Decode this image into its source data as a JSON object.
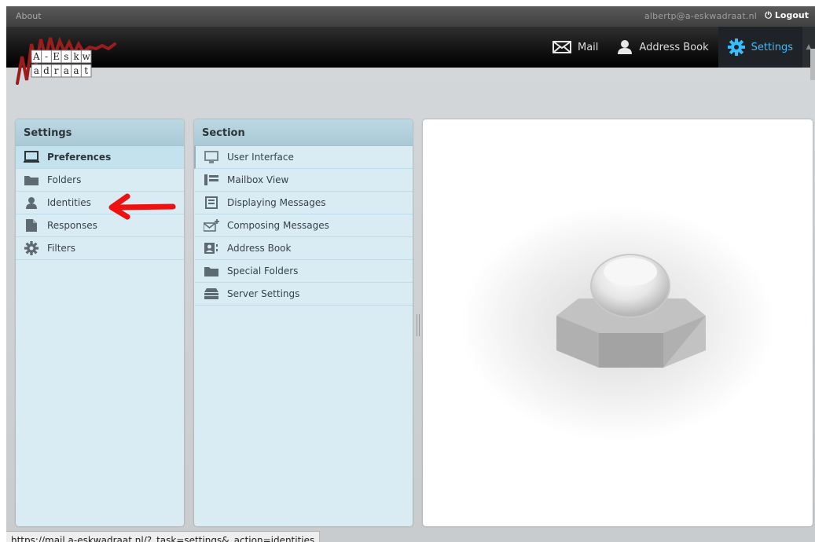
{
  "topbar": {
    "about_label": "About",
    "user_email": "albertp@a-eskwadraat.nl",
    "logout_label": "Logout"
  },
  "logo": {
    "row1": [
      "A",
      "-",
      "E",
      "s",
      "k",
      "w"
    ],
    "row2": [
      "a",
      "d",
      "r",
      "a",
      "a",
      "t"
    ]
  },
  "nav": {
    "items": [
      {
        "label": "Mail",
        "icon": "mail-icon"
      },
      {
        "label": "Address Book",
        "icon": "person-icon"
      },
      {
        "label": "Settings",
        "icon": "gear-icon",
        "active": true
      }
    ],
    "active_color": "#37beff"
  },
  "settings_panel": {
    "title": "Settings",
    "items": [
      {
        "label": "Preferences",
        "icon": "monitor-icon",
        "selected": true
      },
      {
        "label": "Folders",
        "icon": "folder-icon"
      },
      {
        "label": "Identities",
        "icon": "person-icon"
      },
      {
        "label": "Responses",
        "icon": "document-icon"
      },
      {
        "label": "Filters",
        "icon": "gear-icon"
      }
    ]
  },
  "section_panel": {
    "title": "Section",
    "items": [
      {
        "label": "User Interface",
        "icon": "monitor-icon"
      },
      {
        "label": "Mailbox View",
        "icon": "list-view-icon"
      },
      {
        "label": "Displaying Messages",
        "icon": "message-view-icon"
      },
      {
        "label": "Composing Messages",
        "icon": "compose-icon"
      },
      {
        "label": "Address Book",
        "icon": "contact-card-icon"
      },
      {
        "label": "Special Folders",
        "icon": "folder-icon"
      },
      {
        "label": "Server Settings",
        "icon": "server-icon"
      }
    ]
  },
  "annotation": {
    "color": "#ee1111"
  },
  "status_bar": {
    "url": "https://mail.a-eskwadraat.nl/?_task=settings&_action=identities"
  }
}
